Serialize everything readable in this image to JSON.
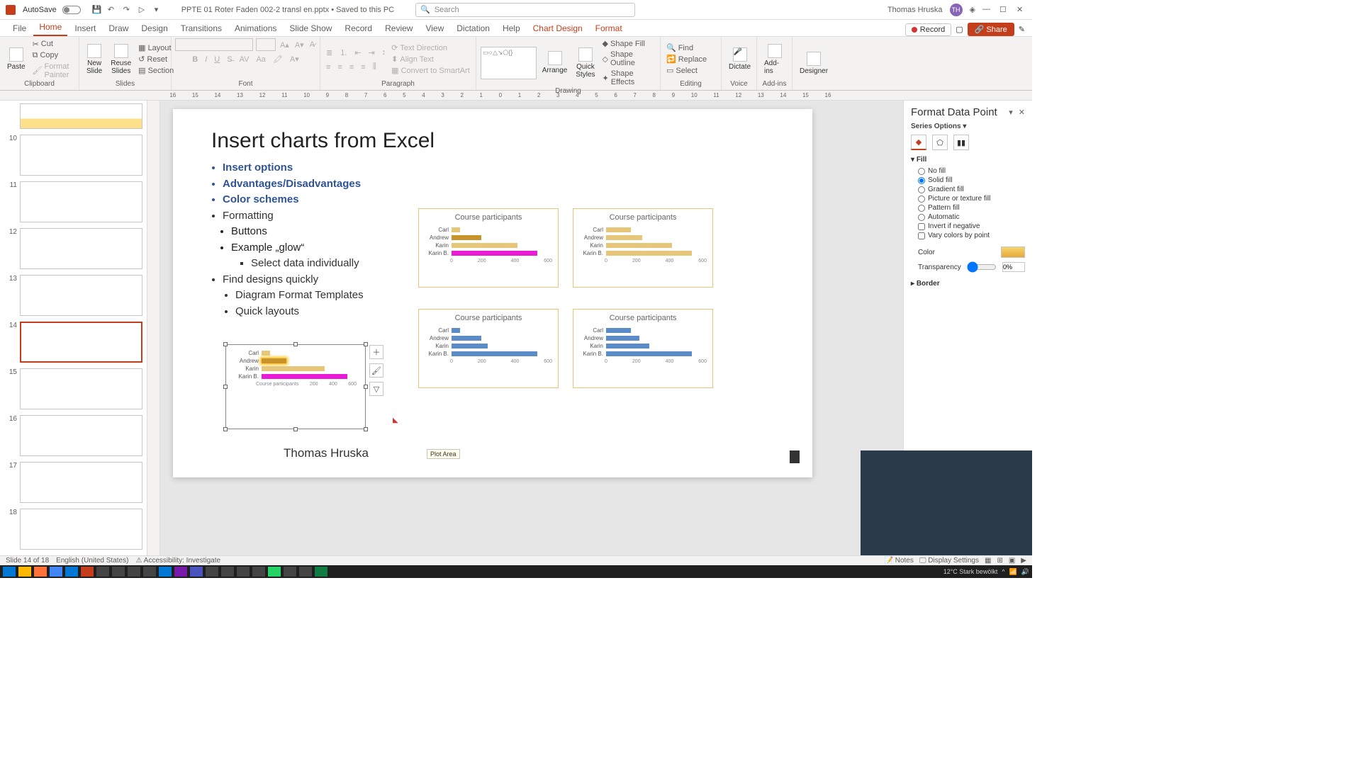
{
  "titlebar": {
    "autosave": "AutoSave",
    "docname": "PPTE 01 Roter Faden 002-2 transl en.pptx • Saved to this PC",
    "search_placeholder": "Search",
    "username": "Thomas Hruska"
  },
  "tabs": {
    "file": "File",
    "home": "Home",
    "insert": "Insert",
    "draw": "Draw",
    "design": "Design",
    "transitions": "Transitions",
    "animations": "Animations",
    "slideshow": "Slide Show",
    "record": "Record",
    "review": "Review",
    "view": "View",
    "dictation": "Dictation",
    "help": "Help",
    "chartdesign": "Chart Design",
    "format": "Format",
    "recbtn": "Record",
    "share": "Share"
  },
  "ribbon": {
    "clipboard": {
      "label": "Clipboard",
      "paste": "Paste",
      "cut": "Cut",
      "copy": "Copy",
      "fp": "Format Painter"
    },
    "slides": {
      "label": "Slides",
      "new": "New\nSlide",
      "reuse": "Reuse\nSlides",
      "layout": "Layout",
      "reset": "Reset",
      "section": "Section"
    },
    "font": {
      "label": "Font"
    },
    "paragraph": {
      "label": "Paragraph",
      "td": "Text Direction",
      "at": "Align Text",
      "cs": "Convert to SmartArt"
    },
    "drawing": {
      "label": "Drawing",
      "arrange": "Arrange",
      "quick": "Quick\nStyles",
      "sf": "Shape Fill",
      "so": "Shape Outline",
      "se": "Shape Effects"
    },
    "editing": {
      "label": "Editing",
      "find": "Find",
      "replace": "Replace",
      "select": "Select"
    },
    "voice": {
      "label": "Voice",
      "dictate": "Dictate"
    },
    "addins": {
      "label": "Add-ins",
      "btn": "Add-ins"
    },
    "designer": {
      "label": "",
      "btn": "Designer"
    }
  },
  "thumbs": [
    {
      "n": "10"
    },
    {
      "n": "11"
    },
    {
      "n": "12"
    },
    {
      "n": "13"
    },
    {
      "n": "14",
      "sel": true
    },
    {
      "n": "15"
    },
    {
      "n": "16"
    },
    {
      "n": "17"
    },
    {
      "n": "18"
    }
  ],
  "slide": {
    "title": "Insert charts from Excel",
    "b1": "Insert options",
    "b2": "Advantages/Disadvantages",
    "b3": "Color schemes",
    "b4": "Formatting",
    "b4a": "Buttons",
    "b4b": "Example „glow“",
    "b4b1": "Select data individually",
    "b5": "Find designs quickly",
    "b5a": "Diagram Format Templates",
    "b5b": "Quick layouts",
    "author": "Thomas Hruska",
    "chart_title": "Course participants",
    "sel_chart_title": "Course participants",
    "plot_tip": "Plot Area"
  },
  "chart_data": [
    {
      "type": "bar",
      "title": "Course participants",
      "categories": [
        "Carl",
        "Andrew",
        "Karin",
        "Karin B."
      ],
      "values": [
        50,
        180,
        400,
        520
      ],
      "xlim": [
        0,
        600
      ],
      "ticks": [
        "0",
        "200",
        "400",
        "600"
      ],
      "colors": [
        "#e6c77a",
        "#c8932a",
        "#e6c77a",
        "#e81cd8"
      ]
    },
    {
      "type": "bar",
      "title": "Course participants",
      "categories": [
        "Carl",
        "Andrew",
        "Karin",
        "Karin B."
      ],
      "values": [
        150,
        220,
        400,
        520
      ],
      "xlim": [
        0,
        600
      ],
      "ticks": [
        "0",
        "200",
        "400",
        "600"
      ],
      "colors": [
        "#e6c77a",
        "#e6c77a",
        "#e6c77a",
        "#e6c77a"
      ]
    },
    {
      "type": "bar",
      "title": "Course participants",
      "categories": [
        "Carl",
        "Andrew",
        "Karin",
        "Karin B."
      ],
      "values": [
        50,
        180,
        220,
        520
      ],
      "xlim": [
        0,
        600
      ],
      "ticks": [
        "0",
        "200",
        "400",
        "600"
      ],
      "colors": [
        "#5b8bc9",
        "#5b8bc9",
        "#5b8bc9",
        "#5b8bc9"
      ]
    },
    {
      "type": "bar",
      "title": "Course participants",
      "categories": [
        "Carl",
        "Andrew",
        "Karin",
        "Karin B."
      ],
      "values": [
        150,
        200,
        260,
        520
      ],
      "xlim": [
        0,
        600
      ],
      "ticks": [
        "0",
        "200",
        "400",
        "600"
      ],
      "colors": [
        "#5b8bc9",
        "#5b8bc9",
        "#5b8bc9",
        "#5b8bc9"
      ]
    },
    {
      "type": "bar",
      "title": "Course participants",
      "categories": [
        "Carl",
        "Andrew",
        "Karin",
        "Karin B."
      ],
      "values": [
        50,
        150,
        380,
        520
      ],
      "xlim": [
        0,
        600
      ],
      "ticks": [
        "200",
        "400",
        "600"
      ],
      "colors": [
        "#e6c77a",
        "#c8932a",
        "#e6c77a",
        "#e81cd8"
      ],
      "selected": true
    }
  ],
  "pane": {
    "title": "Format Data Point",
    "series": "Series Options",
    "fill": "Fill",
    "nofill": "No fill",
    "solid": "Solid fill",
    "grad": "Gradient fill",
    "pic": "Picture or texture fill",
    "patt": "Pattern fill",
    "auto": "Automatic",
    "invneg": "Invert if negative",
    "vary": "Vary colors by point",
    "color": "Color",
    "transp": "Transparency",
    "transp_val": "0%",
    "border": "Border"
  },
  "status": {
    "slide": "Slide 14 of 18",
    "lang": "English (United States)",
    "acc": "Accessibility: Investigate",
    "notes": "Notes",
    "disp": "Display Settings"
  },
  "taskbar": {
    "weather": "12°C  Stark bewölkt"
  },
  "ruler_marks": [
    "16",
    "15",
    "14",
    "13",
    "12",
    "11",
    "10",
    "9",
    "8",
    "7",
    "6",
    "5",
    "4",
    "3",
    "2",
    "1",
    "0",
    "1",
    "2",
    "3",
    "4",
    "5",
    "6",
    "7",
    "8",
    "9",
    "10",
    "11",
    "12",
    "13",
    "14",
    "15",
    "16"
  ]
}
